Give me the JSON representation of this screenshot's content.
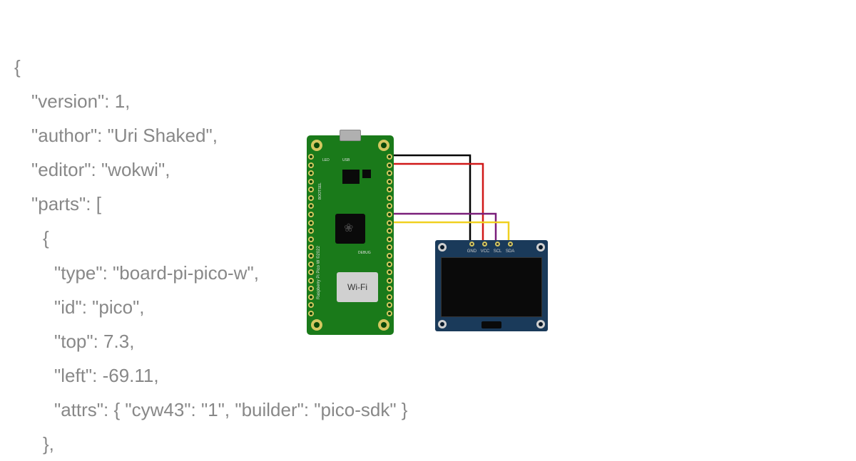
{
  "code": {
    "line0": "{",
    "line1": "\"version\": 1,",
    "line2": "\"author\": \"Uri Shaked\",",
    "line3": "\"editor\": \"wokwi\",",
    "line4": "\"parts\": [",
    "line5": "{",
    "line6": "\"type\": \"board-pi-pico-w\",",
    "line7": "\"id\": \"pico\",",
    "line8": "\"top\": 7.3,",
    "line9": "\"left\": -69.11,",
    "line10": "\"attrs\": { \"cyw43\": \"1\", \"builder\": \"pico-sdk\" }",
    "line11": "},"
  },
  "pico": {
    "led_label": "LED",
    "usb_label": "USB",
    "bootsel_label": "BOOTSEL",
    "debug_label": "DEBUG",
    "wifi_label": "Wi-Fi",
    "side_label": "Raspberry Pi Pico W ©2022"
  },
  "oled": {
    "pin1": "GND",
    "pin2": "VCC",
    "pin3": "SCL",
    "pin4": "SDA"
  },
  "wires": {
    "colors": {
      "gnd": "#000000",
      "vcc": "#d01818",
      "scl": "#7a1f7a",
      "sda": "#f0d020"
    }
  }
}
